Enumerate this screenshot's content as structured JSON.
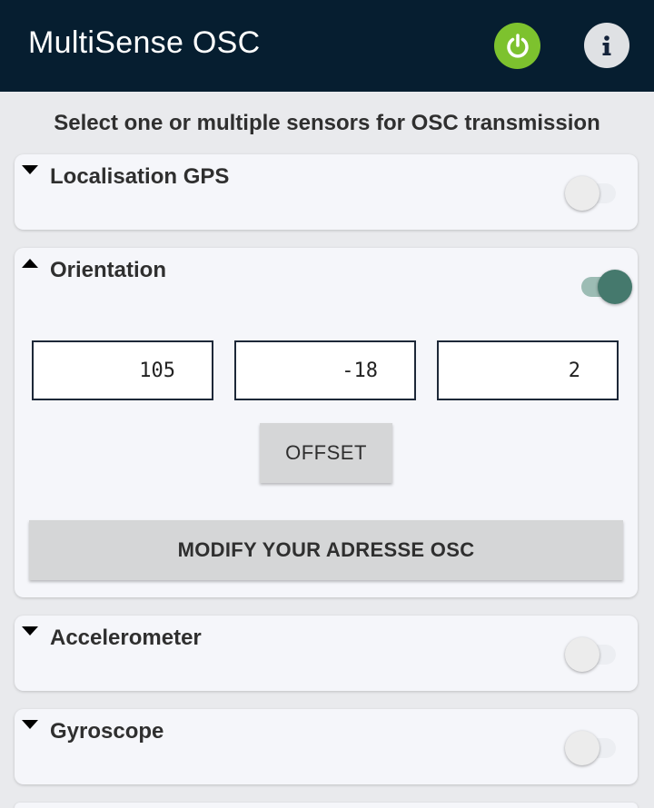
{
  "app": {
    "title": "MultiSense OSC"
  },
  "header": {
    "power_icon": "power-icon",
    "info_icon": "info-icon",
    "power_color": "#7dc22e",
    "bar_color": "#061e30"
  },
  "subtitle": "Select one or multiple sensors for OSC transmission",
  "sensors": [
    {
      "label": "Localisation GPS",
      "expanded": false,
      "enabled": false
    },
    {
      "label": "Orientation",
      "expanded": true,
      "enabled": true
    },
    {
      "label": "Accelerometer",
      "expanded": false,
      "enabled": false
    },
    {
      "label": "Gyroscope",
      "expanded": false,
      "enabled": false
    }
  ],
  "orientation": {
    "values": [
      "105",
      "-18",
      "2"
    ],
    "offset_label": "OFFSET",
    "modify_label": "MODIFY YOUR ADRESSE OSC"
  },
  "colors": {
    "toggle_on": "#45796d",
    "toggle_off": "#ececec"
  }
}
